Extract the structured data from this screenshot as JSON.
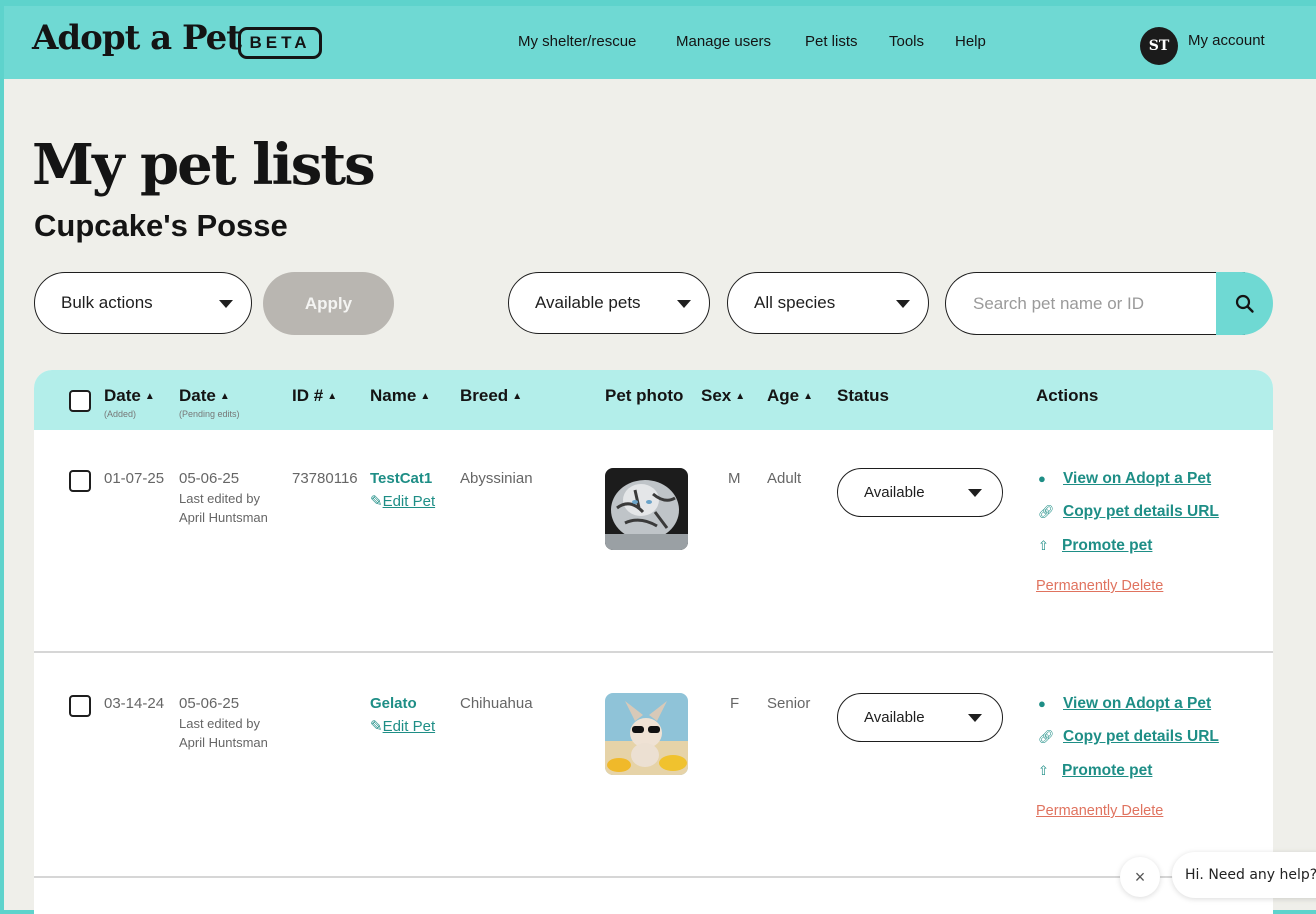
{
  "header": {
    "logo": "Adopt a Pet",
    "badge": "BETA",
    "nav": [
      "My shelter/rescue",
      "Manage users",
      "Pet lists",
      "Tools",
      "Help"
    ],
    "avatar_initials": "ST",
    "account": "My account"
  },
  "page": {
    "title": "My pet lists",
    "list_name": "Cupcake's Posse"
  },
  "controls": {
    "bulk_actions": "Bulk actions",
    "apply": "Apply",
    "filter_pets": "Available pets",
    "filter_species": "All species",
    "search_placeholder": "Search pet name or ID"
  },
  "table": {
    "headers": {
      "date_added": "Date",
      "date_added_sub": "(Added)",
      "date_pending": "Date",
      "date_pending_sub": "(Pending edits)",
      "id": "ID #",
      "name": "Name",
      "breed": "Breed",
      "photo": "Pet photo",
      "sex": "Sex",
      "age": "Age",
      "status": "Status",
      "actions": "Actions"
    },
    "rows": [
      {
        "date_added": "01-07-25",
        "date_pending": "05-06-25",
        "edited_by_1": "Last edited by",
        "edited_by_2": "April Huntsman",
        "id": "73780116",
        "name": "TestCat1",
        "edit": "Edit Pet",
        "breed": "Abyssinian",
        "sex": "M",
        "age": "Adult",
        "status": "Available",
        "view": "View on Adopt a Pet",
        "copy": "Copy pet details URL",
        "promote": "Promote pet",
        "delete": "Permanently Delete"
      },
      {
        "date_added": "03-14-24",
        "date_pending": "05-06-25",
        "edited_by_1": "Last edited by",
        "edited_by_2": "April Huntsman",
        "id": "",
        "name": "Gelato",
        "edit": "Edit Pet",
        "breed": "Chihuahua",
        "sex": "F",
        "age": "Senior",
        "status": "Available",
        "view": "View on Adopt a Pet",
        "copy": "Copy pet details URL",
        "promote": "Promote pet",
        "delete": "Permanently Delete"
      }
    ]
  },
  "chat": {
    "close": "×",
    "prompt": "Hi. Need any help?"
  },
  "colors": {
    "brand": "#6fd9d3",
    "link": "#1e8e86",
    "danger": "#e0735f"
  }
}
